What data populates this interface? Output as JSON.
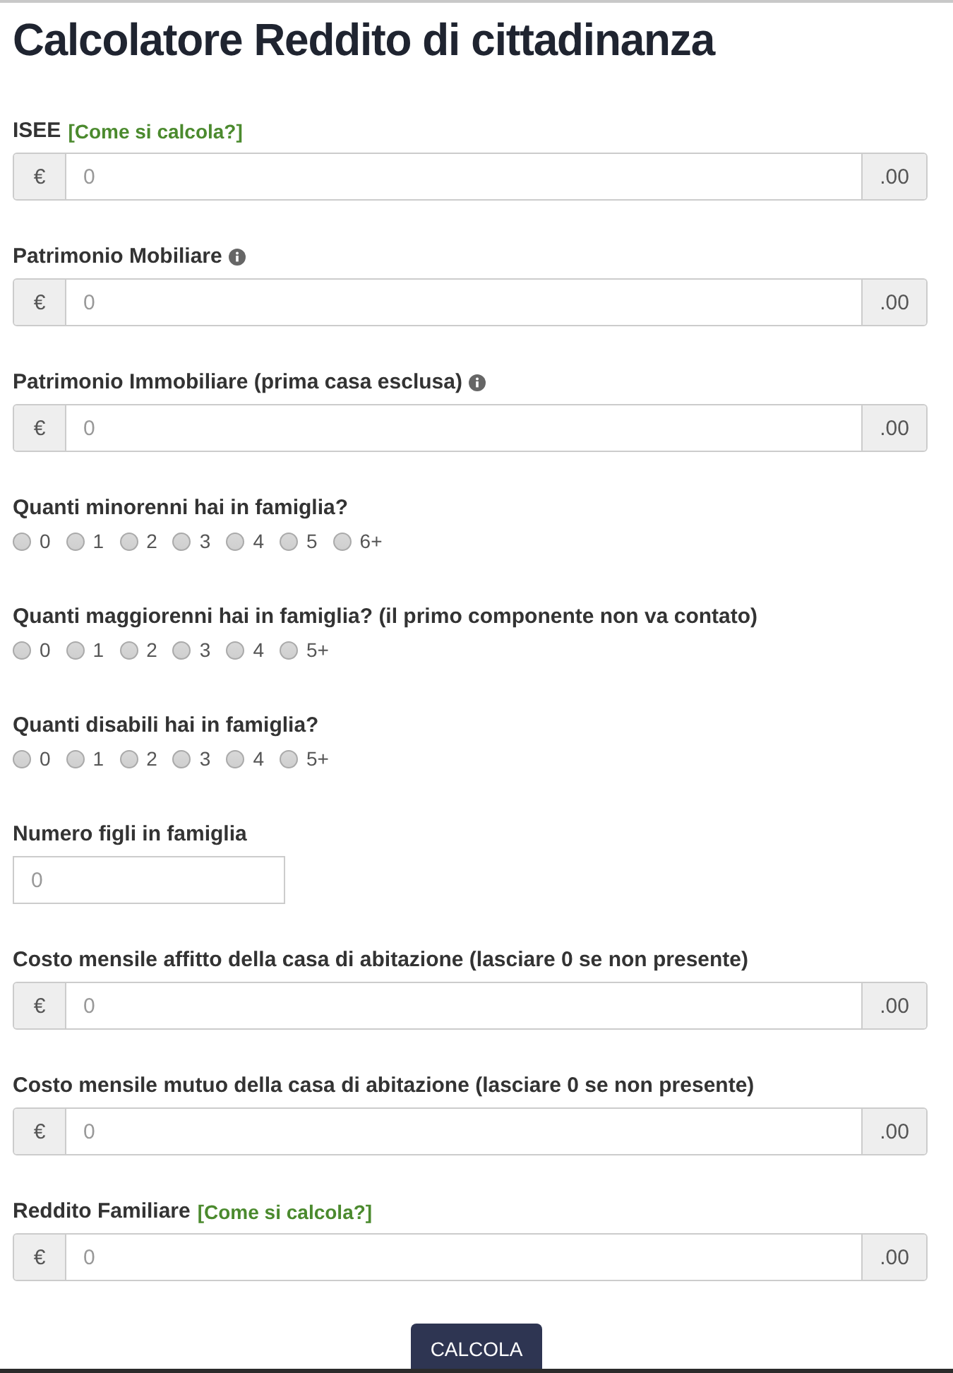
{
  "title": "Calcolatore Reddito di cittadinanza",
  "fields": [
    {
      "kind": "money",
      "label": "ISEE",
      "link": "[Come si calcola?]",
      "info": false,
      "prefix": "€",
      "placeholder": "0",
      "suffix": ".00"
    },
    {
      "kind": "money",
      "label": "Patrimonio Mobiliare",
      "info": true,
      "prefix": "€",
      "placeholder": "0",
      "suffix": ".00"
    },
    {
      "kind": "money",
      "label": "Patrimonio Immobiliare (prima casa esclusa)",
      "info": true,
      "prefix": "€",
      "placeholder": "0",
      "suffix": ".00"
    },
    {
      "kind": "radio",
      "label": "Quanti minorenni hai in famiglia?",
      "options": [
        {
          "label": "0",
          "selected": false
        },
        {
          "label": "1",
          "selected": false
        },
        {
          "label": "2",
          "selected": false
        },
        {
          "label": "3",
          "selected": false
        },
        {
          "label": "4",
          "selected": false
        },
        {
          "label": "5",
          "selected": false
        },
        {
          "label": "6+",
          "selected": false
        }
      ]
    },
    {
      "kind": "radio",
      "label": "Quanti maggiorenni hai in famiglia? (il primo componente non va contato)",
      "options": [
        {
          "label": "0",
          "selected": false
        },
        {
          "label": "1",
          "selected": false
        },
        {
          "label": "2",
          "selected": false
        },
        {
          "label": "3",
          "selected": false
        },
        {
          "label": "4",
          "selected": false
        },
        {
          "label": "5+",
          "selected": false
        }
      ]
    },
    {
      "kind": "radio",
      "label": "Quanti disabili hai in famiglia?",
      "options": [
        {
          "label": "0",
          "selected": false
        },
        {
          "label": "1",
          "selected": false
        },
        {
          "label": "2",
          "selected": false
        },
        {
          "label": "3",
          "selected": false
        },
        {
          "label": "4",
          "selected": false
        },
        {
          "label": "5+",
          "selected": false
        }
      ]
    },
    {
      "kind": "number",
      "label": "Numero figli in famiglia",
      "placeholder": "0"
    },
    {
      "kind": "money",
      "label": "Costo mensile affitto della casa di abitazione (lasciare 0 se non presente)",
      "info": false,
      "prefix": "€",
      "placeholder": "0",
      "suffix": ".00"
    },
    {
      "kind": "money",
      "label": "Costo mensile mutuo della casa di abitazione (lasciare 0 se non presente)",
      "info": false,
      "prefix": "€",
      "placeholder": "0",
      "suffix": ".00"
    },
    {
      "kind": "money",
      "label": "Reddito Familiare",
      "link": "[Come si calcola?]",
      "info": false,
      "prefix": "€",
      "placeholder": "0",
      "suffix": ".00"
    }
  ],
  "button": "CALCOLA"
}
